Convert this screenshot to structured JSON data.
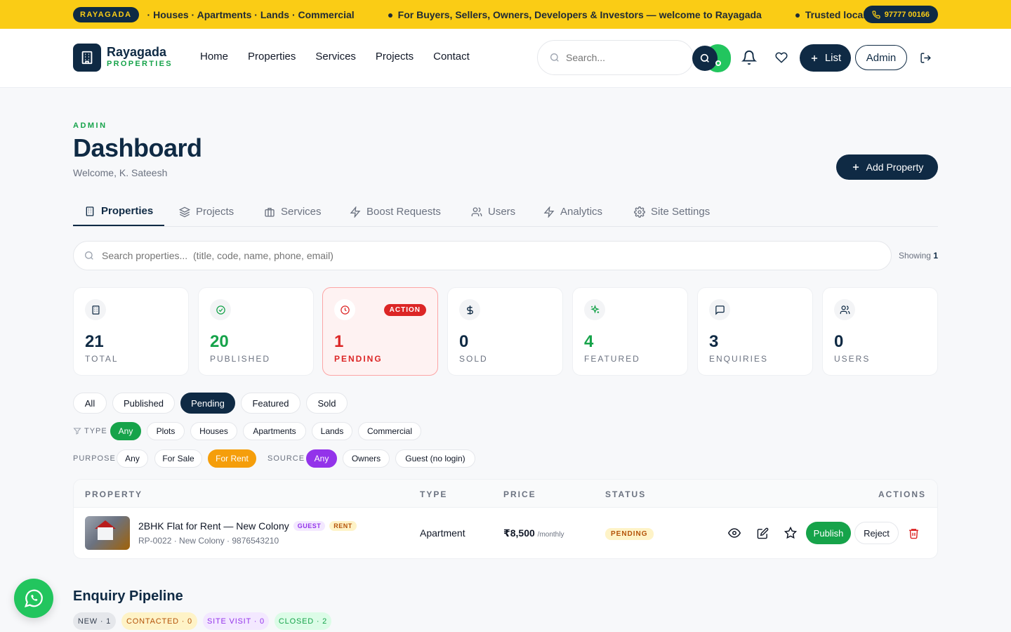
{
  "ticker": {
    "brand": "RAYAGADA",
    "msg1": "· Houses · Apartments · Lands · Commercial",
    "msg2": "For Buyers, Sellers, Owners, Developers & Investors — welcome to Rayagada",
    "msg3": "Trusted local pr",
    "phone": "97777 00166"
  },
  "header": {
    "logo_name": "Rayagada",
    "logo_sub": "PROPERTIES",
    "nav": [
      "Home",
      "Properties",
      "Services",
      "Projects",
      "Contact"
    ],
    "search_placeholder": "Search...",
    "list_label": "List",
    "admin_label": "Admin"
  },
  "page": {
    "eyebrow": "ADMIN",
    "title": "Dashboard",
    "welcome": "Welcome, K. Sateesh",
    "add_property": "Add Property"
  },
  "tabs": [
    "Properties",
    "Projects",
    "Services",
    "Boost Requests",
    "Users",
    "Analytics",
    "Site Settings"
  ],
  "search": {
    "placeholder": "Search properties...  (title, code, name, phone, email)",
    "showing_label": "Showing",
    "showing_count": "1"
  },
  "stats": [
    {
      "value": "21",
      "label": "TOTAL",
      "icon": "building-icon",
      "color": "#0f2a44"
    },
    {
      "value": "20",
      "label": "PUBLISHED",
      "icon": "check-circle-icon",
      "color": "#16a34a"
    },
    {
      "value": "1",
      "label": "PENDING",
      "icon": "clock-icon",
      "color": "#dc2626",
      "badge": "ACTION"
    },
    {
      "value": "0",
      "label": "SOLD",
      "icon": "dollar-icon",
      "color": "#0f2a44"
    },
    {
      "value": "4",
      "label": "FEATURED",
      "icon": "sparkle-icon",
      "color": "#16a34a"
    },
    {
      "value": "3",
      "label": "ENQUIRIES",
      "icon": "message-icon",
      "color": "#0f2a44"
    },
    {
      "value": "0",
      "label": "USERS",
      "icon": "users-icon",
      "color": "#0f2a44"
    }
  ],
  "status_filters": [
    "All",
    "Published",
    "Pending",
    "Featured",
    "Sold"
  ],
  "type_filter": {
    "label": "TYPE",
    "options": [
      "Any",
      "Plots",
      "Houses",
      "Apartments",
      "Lands",
      "Commercial"
    ]
  },
  "purpose_filter": {
    "label": "PURPOSE",
    "options": [
      "Any",
      "For Sale",
      "For Rent"
    ]
  },
  "source_filter": {
    "label": "SOURCE",
    "options": [
      "Any",
      "Owners",
      "Guest (no login)"
    ]
  },
  "table": {
    "headers": [
      "PROPERTY",
      "TYPE",
      "PRICE",
      "STATUS",
      "ACTIONS"
    ],
    "row": {
      "title": "2BHK Flat for Rent — New Colony",
      "tag_guest": "GUEST",
      "tag_rent": "RENT",
      "meta": "RP-0022 · New Colony · 9876543210",
      "type": "Apartment",
      "price": "₹8,500",
      "price_unit": "/monthly",
      "status": "PENDING",
      "publish": "Publish",
      "reject": "Reject"
    }
  },
  "pipeline": {
    "title": "Enquiry Pipeline",
    "stages": [
      "NEW · 1",
      "CONTACTED · 0",
      "SITE VISIT · 0",
      "CLOSED · 2"
    ]
  }
}
